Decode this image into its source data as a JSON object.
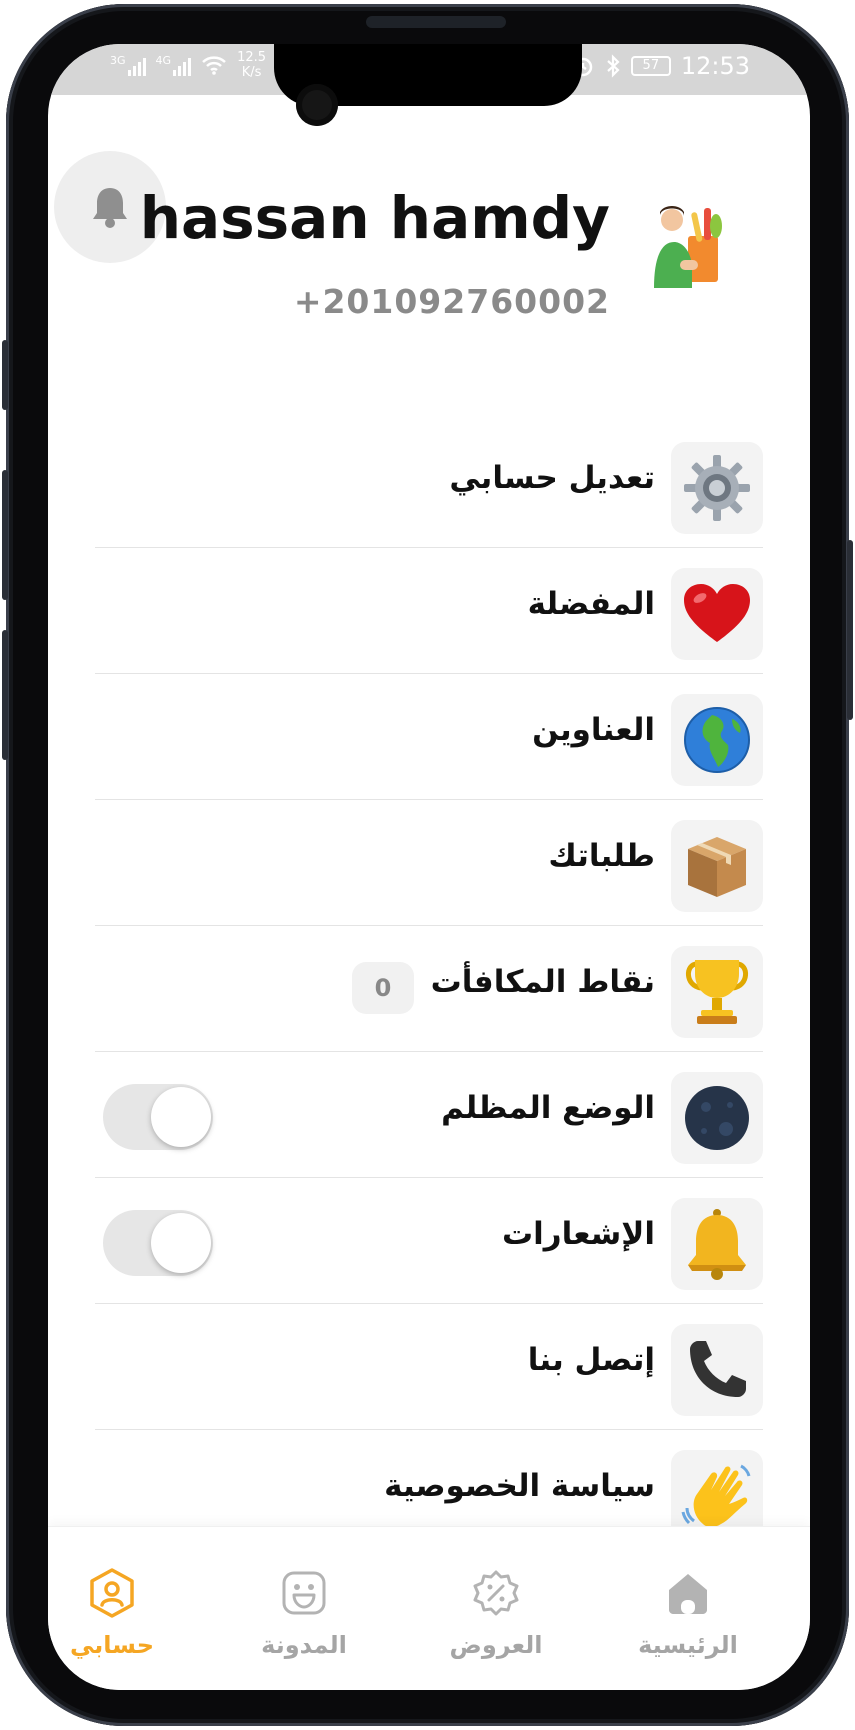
{
  "status_bar": {
    "network_1": "3G",
    "network_2": "4G",
    "speed_value": "12.5",
    "speed_unit": "K/s",
    "battery": "57",
    "time": "12:53"
  },
  "profile": {
    "name": "hassan hamdy",
    "phone": "+201092760002"
  },
  "menu": {
    "items": [
      {
        "label": "تعديل حسابي",
        "icon": "gear-icon"
      },
      {
        "label": "المفضلة",
        "icon": "heart-icon"
      },
      {
        "label": "العناوين",
        "icon": "globe-icon"
      },
      {
        "label": "طلباتك",
        "icon": "package-icon"
      },
      {
        "label": "نقاط المكافأت",
        "icon": "trophy-icon",
        "badge": "0"
      },
      {
        "label": "الوضع المظلم",
        "icon": "moon-icon",
        "toggle": false
      },
      {
        "label": "الإشعارات",
        "icon": "bell-icon",
        "toggle": false
      },
      {
        "label": "إتصل بنا",
        "icon": "phone-icon"
      },
      {
        "label": "سياسة الخصوصية",
        "icon": "waving-hand-icon"
      }
    ]
  },
  "tabs": [
    {
      "label": "الرئيسية",
      "icon": "home-icon",
      "active": false
    },
    {
      "label": "العروض",
      "icon": "discount-icon",
      "active": false
    },
    {
      "label": "المدونة",
      "icon": "blog-smile-icon",
      "active": false
    },
    {
      "label": "حسابي",
      "icon": "profile-icon",
      "active": true
    }
  ],
  "colors": {
    "accent": "#f5a623",
    "inactive_tab": "#a5a5a5",
    "text": "#111111",
    "muted": "#8a8a8a"
  }
}
